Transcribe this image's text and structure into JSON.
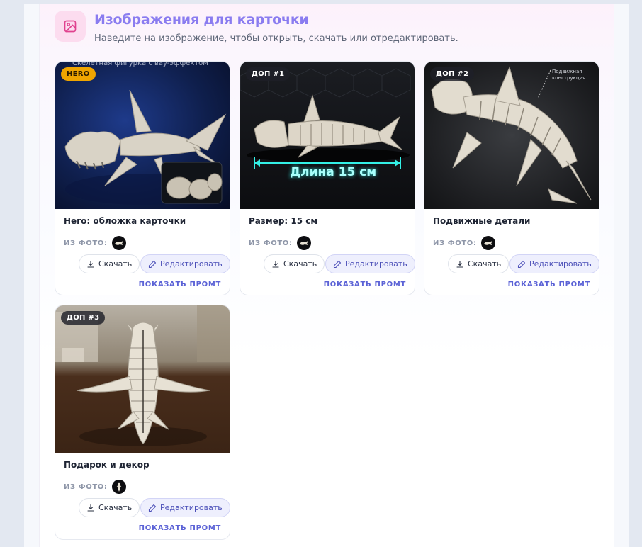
{
  "header": {
    "title": "Изображения для карточки",
    "subtitle": "Наведите на изображение, чтобы открыть, скачать или отредактировать."
  },
  "icons": {
    "header": "image-icon",
    "download": "download-icon",
    "edit": "pencil-icon"
  },
  "colors": {
    "accent": "#8a7cf0",
    "hero_badge": "#f0a500",
    "edit_button_bg": "#eeeffd",
    "prompt_link": "#5b62d6"
  },
  "common": {
    "from_photo_label": "ИЗ ФОТО:",
    "download_label": "Скачать",
    "edit_label": "Редактировать",
    "show_prompt_label": "ПОКАЗАТЬ ПРОМТ"
  },
  "cards": [
    {
      "badge": "HERO",
      "title": "Hero: обложка карточки",
      "overlay_text": "Скелетная фигурка с вау-эффектом"
    },
    {
      "badge": "ДОП #1",
      "title": "Размер: 15 см",
      "overlay_text": "Длина 15 см"
    },
    {
      "badge": "ДОП #2",
      "title": "Подвижные детали",
      "overlay_text": "Подвижная конструкция"
    },
    {
      "badge": "ДОП #3",
      "title": "Подарок и декор"
    }
  ]
}
